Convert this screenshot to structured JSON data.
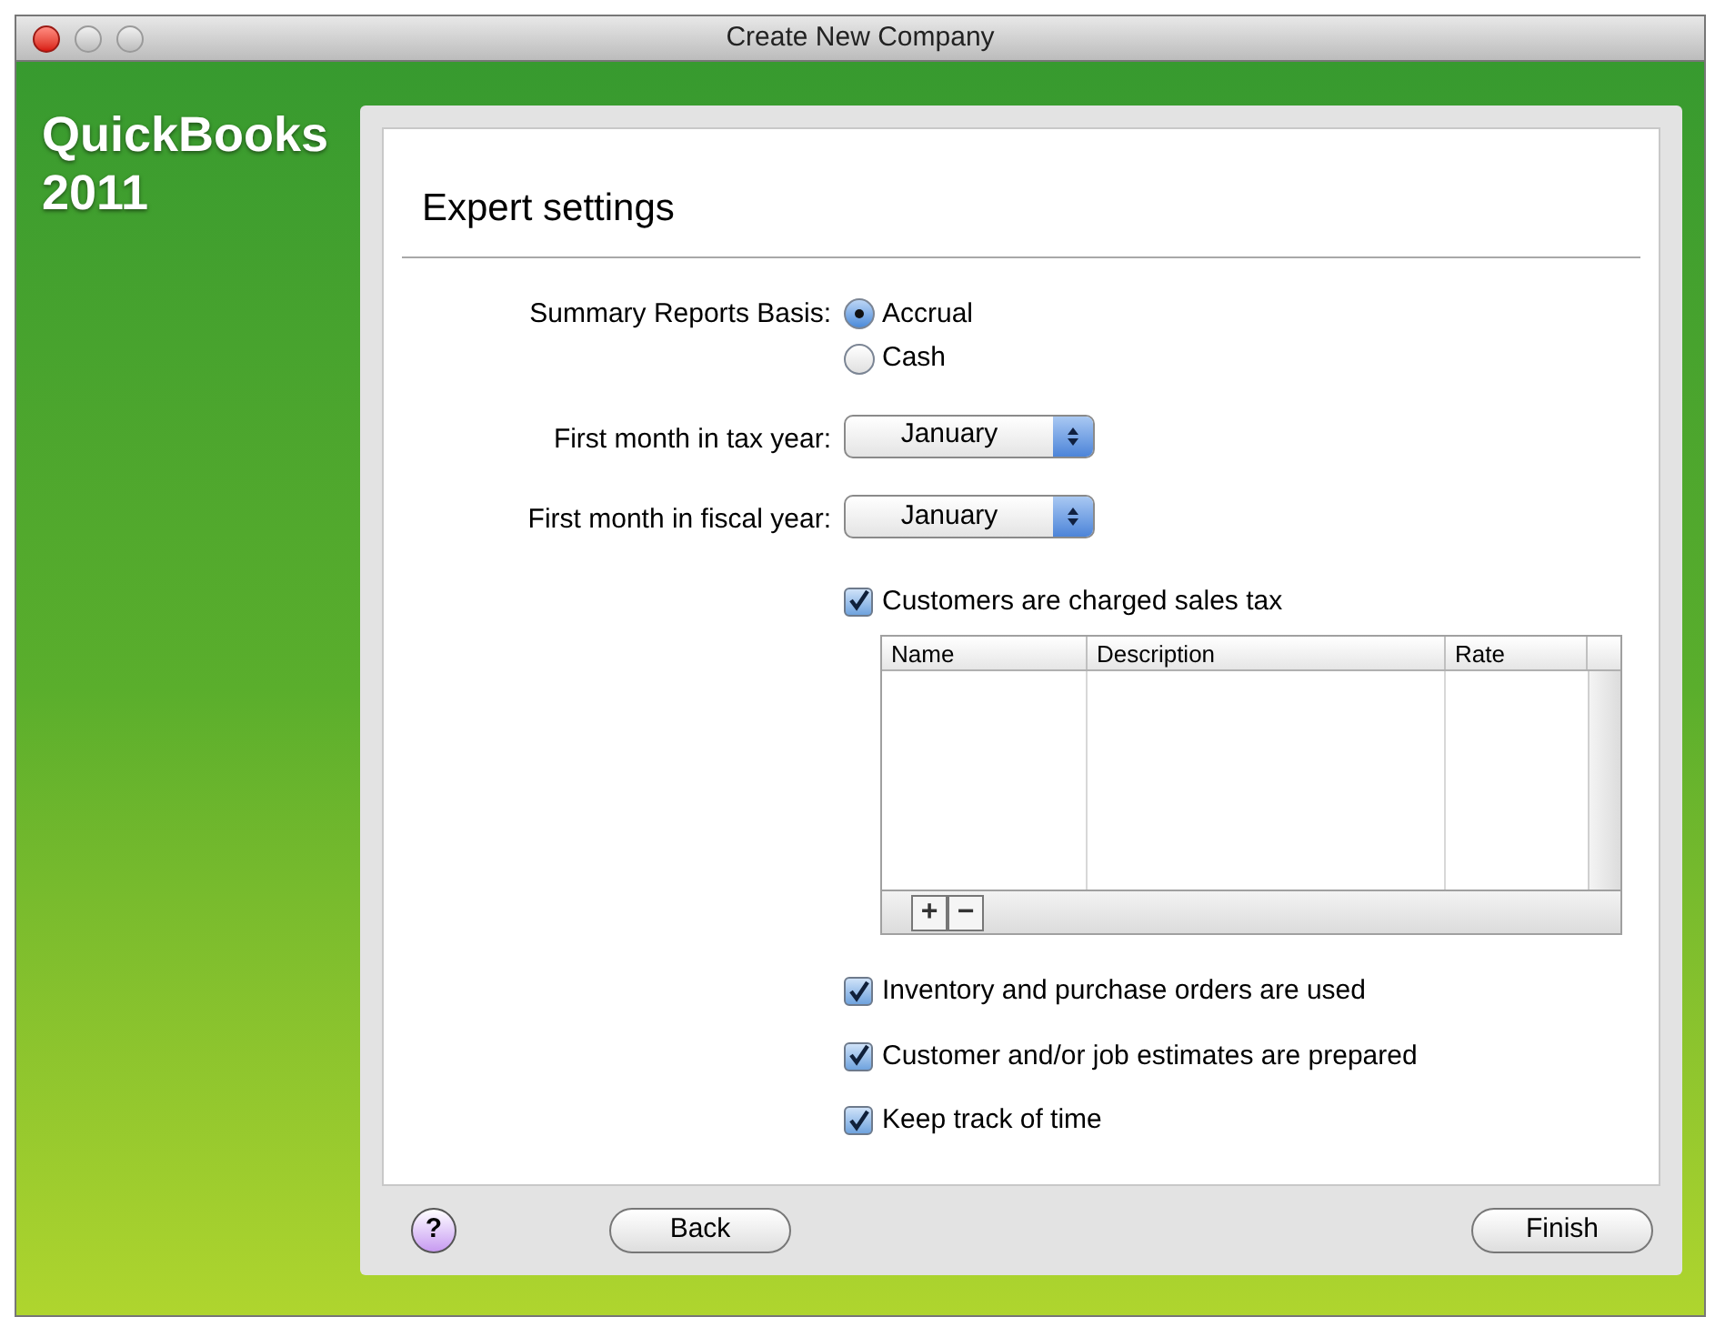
{
  "window": {
    "title": "Create New Company"
  },
  "brand": {
    "name": "QuickBooks",
    "version": "2011"
  },
  "heading": "Expert settings",
  "basis": {
    "label": "Summary Reports Basis:",
    "options": [
      {
        "label": "Accrual",
        "selected": true
      },
      {
        "label": "Cash",
        "selected": false
      }
    ]
  },
  "selects": [
    {
      "label": "First month in tax year:",
      "value": "January"
    },
    {
      "label": "First month in fiscal year:",
      "value": "January"
    }
  ],
  "sales_tax": {
    "label": "Customers are charged sales tax",
    "checked": true
  },
  "table": {
    "columns": [
      "Name",
      "Description",
      "Rate"
    ],
    "add": "+",
    "remove": "−"
  },
  "options": [
    {
      "label": "Inventory and purchase orders are used",
      "checked": true
    },
    {
      "label": "Customer and/or job estimates are prepared",
      "checked": true
    },
    {
      "label": "Keep track of time",
      "checked": true
    }
  ],
  "footer": {
    "help": "?",
    "back": "Back",
    "finish": "Finish"
  }
}
